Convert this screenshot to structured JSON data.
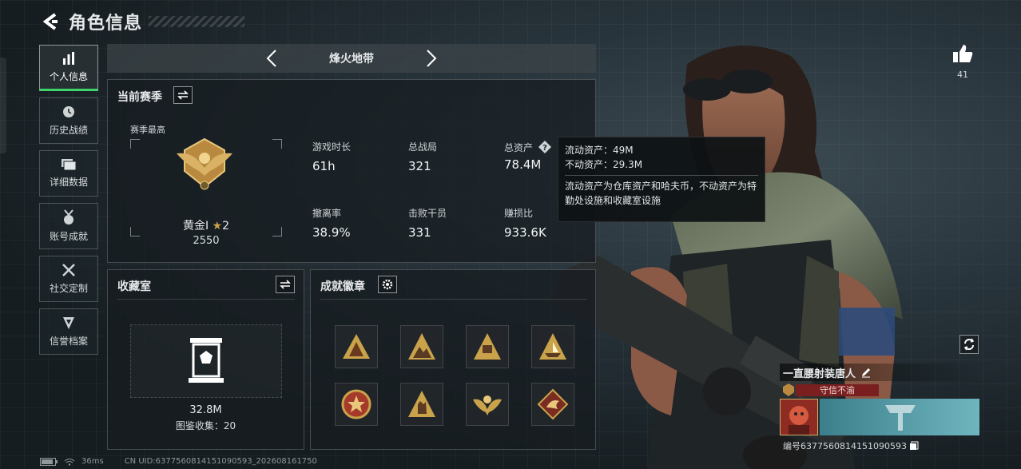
{
  "header": {
    "title": "角色信息"
  },
  "nav": {
    "items": [
      {
        "label": "个人信息",
        "icon": "bar-chart-icon",
        "active": true
      },
      {
        "label": "历史战绩",
        "icon": "history-icon",
        "active": false
      },
      {
        "label": "详细数据",
        "icon": "folder-icon",
        "active": false
      },
      {
        "label": "账号成就",
        "icon": "medal-icon",
        "active": false
      },
      {
        "label": "社交定制",
        "icon": "tools-icon",
        "active": false
      },
      {
        "label": "信誉档案",
        "icon": "shield-icon",
        "active": false
      }
    ]
  },
  "mode_bar": {
    "title": "烽火地带"
  },
  "season": {
    "title": "当前赛季",
    "best_label": "赛季最高",
    "rank_name": "黄金Ⅰ",
    "rank_stars": "2",
    "rank_score": "2550",
    "stats": [
      {
        "label": "游戏时长",
        "value": "61h"
      },
      {
        "label": "总战局",
        "value": "321"
      },
      {
        "label": "总资产",
        "value": "78.4M"
      },
      {
        "label": "撤离率",
        "value": "38.9%"
      },
      {
        "label": "击败干员",
        "value": "331"
      },
      {
        "label": "赚损比",
        "value": "933.6K"
      }
    ]
  },
  "tooltip": {
    "line1": "流动资产：49M",
    "line2": "不动资产：29.3M",
    "desc": "流动资产为仓库资产和哈夫币，不动资产为特勤处设施和收藏室设施"
  },
  "collection": {
    "title": "收藏室",
    "value": "32.8M",
    "count_text": "图鉴收集：20"
  },
  "achievements": {
    "title": "成就徽章",
    "badges": [
      "triangle-tent-badge",
      "mountain-badge",
      "sign-badge",
      "boat-badge",
      "star-shield-badge",
      "hand-badge",
      "eagle-badge",
      "dragon-badge"
    ]
  },
  "like": {
    "count": "41"
  },
  "profile": {
    "name": "一直腰射装唐人",
    "title": "守信不渝",
    "uid": "编号6377560814151090593"
  },
  "status": {
    "ping": "36ms",
    "uid": "CN UID:6377560814151090593_202608161750"
  },
  "colors": {
    "accent_green": "#3fd36b",
    "gold": "#c9a24a",
    "title_red": "#7a1f1f"
  }
}
